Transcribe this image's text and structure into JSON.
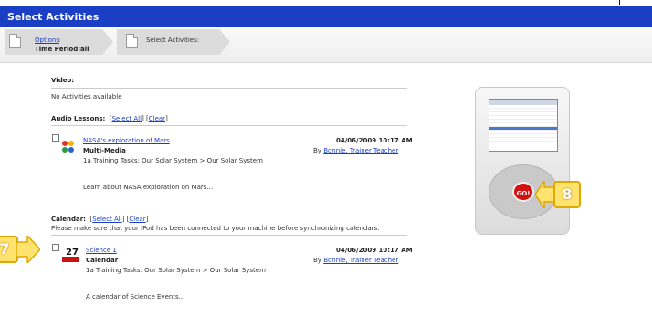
{
  "window": {
    "title": "Select Activities"
  },
  "breadcrumb": {
    "step1_link": "Options",
    "step1_colon": ":",
    "step1_sub": "Time Period:all",
    "step2_label": "Select Activities:"
  },
  "video": {
    "heading": "Video:",
    "empty": "No Activities available"
  },
  "audio": {
    "heading": "Audio Lessons:",
    "select_all": "Select All",
    "clear": "Clear",
    "item": {
      "title": "NASA's exploration of Mars",
      "type": "Multi-Media",
      "path": "1a Training Tasks: Our Solar System > Our Solar System",
      "date": "04/06/2009 10:17 AM",
      "by": "By",
      "author": "Bonnie, Trainer Teacher",
      "desc": "Learn about NASA exploration on Mars..."
    }
  },
  "calendar": {
    "heading": "Calendar:",
    "select_all": "Select All",
    "clear": "Clear",
    "note": "Please make sure that your iPod has been connected to your machine before synchronizing calendars.",
    "item": {
      "icon_day": "27",
      "title": "Science 1",
      "type": "Calendar",
      "path": "1a Training Tasks: Our Solar System > Our Solar System",
      "date": "04/06/2009 10:17 AM",
      "by": "By",
      "author": "Bonnie, Trainer Teacher",
      "desc": "A calendar of Science Events..."
    }
  },
  "ipod": {
    "go_label": "GO!"
  },
  "callouts": {
    "left": "7",
    "right": "8"
  },
  "colors": {
    "title_bar": "#1a3fc4",
    "link": "#1a3fc4",
    "callout": "#ffe36e",
    "go_button": "#d41010"
  }
}
